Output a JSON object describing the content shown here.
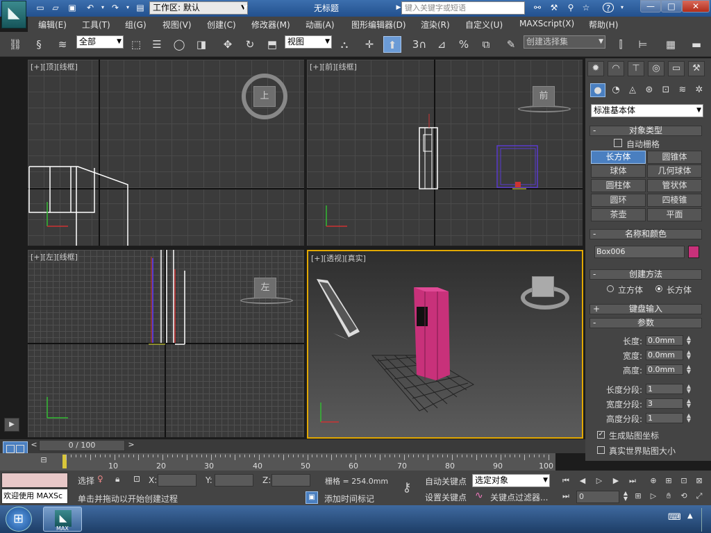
{
  "titlebar": {
    "workspace": "工作区: 默认",
    "title": "无标题",
    "search_placeholder": "键入关键字或短语",
    "btn_min": "—",
    "btn_max": "□",
    "btn_close": "✕"
  },
  "menu": [
    "编辑(E)",
    "工具(T)",
    "组(G)",
    "视图(V)",
    "创建(C)",
    "修改器(M)",
    "动画(A)",
    "图形编辑器(D)",
    "渲染(R)",
    "自定义(U)",
    "MAXScript(X)",
    "帮助(H)"
  ],
  "toolbar": {
    "filter": "全部",
    "refcoord": "视图",
    "selset": "创建选择集",
    "snap3": "3",
    "pct": "%"
  },
  "viewports": {
    "top": {
      "label": "[+][顶][线框]",
      "cube": "上"
    },
    "front": {
      "label": "[+][前][线框]",
      "cube": "前"
    },
    "left": {
      "label": "[+][左][线框]",
      "cube": "左"
    },
    "persp": {
      "label": "[+][透视][真实]"
    }
  },
  "cmdpanel": {
    "category": "标准基本体",
    "rollouts": {
      "objtype": "对象类型",
      "name_color": "名称和颜色",
      "create_method": "创建方法",
      "keyboard": "键盘输入",
      "params": "参数"
    },
    "autogrid": "自动栅格",
    "objects": [
      "长方体",
      "圆锥体",
      "球体",
      "几何球体",
      "圆柱体",
      "管状体",
      "圆环",
      "四棱锥",
      "茶壶",
      "平面"
    ],
    "object_name": "Box006",
    "object_color": "#c8317a",
    "methods": [
      "立方体",
      "长方体"
    ],
    "params": [
      {
        "label": "长度:",
        "value": "0.0mm"
      },
      {
        "label": "宽度:",
        "value": "0.0mm"
      },
      {
        "label": "高度:",
        "value": "0.0mm"
      }
    ],
    "segs": [
      {
        "label": "长度分段:",
        "value": "1"
      },
      {
        "label": "宽度分段:",
        "value": "3"
      },
      {
        "label": "高度分段:",
        "value": "1"
      }
    ],
    "gen_map": "生成贴图坐标",
    "real_world": "真实世界贴图大小"
  },
  "timeline": {
    "frame": "0 / 100",
    "ticks": [
      "10",
      "20",
      "30",
      "40",
      "50",
      "60",
      "70",
      "80",
      "90",
      "100"
    ]
  },
  "status": {
    "welcome": "欢迎使用 MAXSc",
    "select": "选择",
    "x": "X:",
    "y": "Y:",
    "z": "Z:",
    "grid": "栅格 = 254.0mm",
    "prompt": "单击并拖动以开始创建过程",
    "add_tag": "添加时间标记",
    "autokey": "自动关键点",
    "setkey": "设置关键点",
    "selobj": "选定对象",
    "keyfilter": "关键点过滤器...",
    "frame": "0"
  },
  "taskbar": {
    "app": "MAX"
  }
}
